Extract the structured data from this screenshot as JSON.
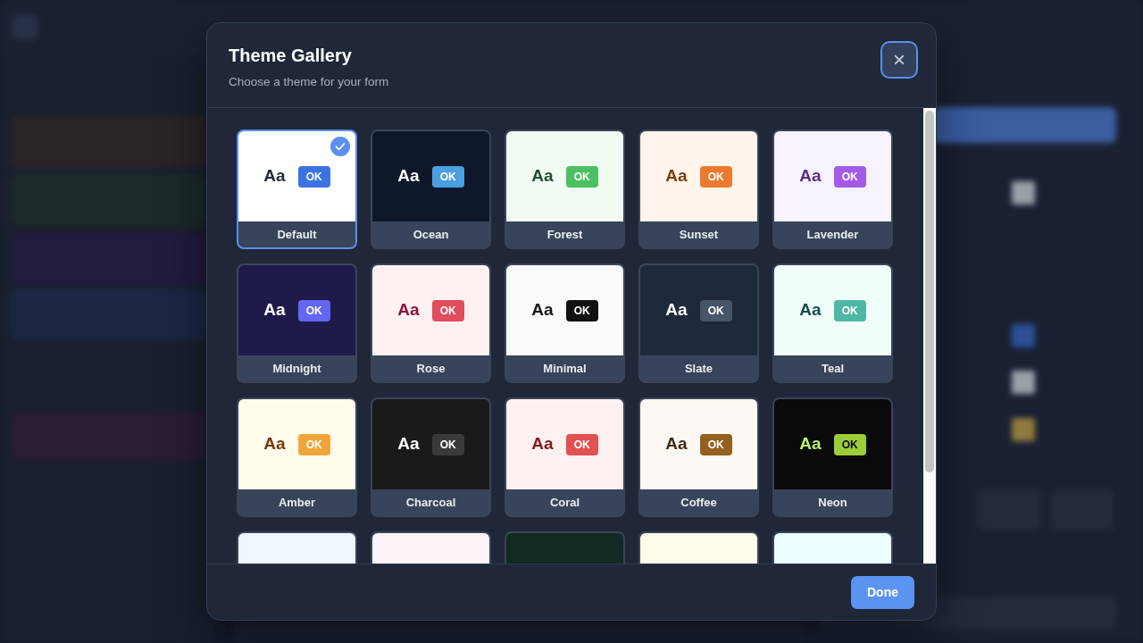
{
  "dialog": {
    "title": "Theme Gallery",
    "subtitle": "Choose a theme for your form",
    "close": "×",
    "done": "Done"
  },
  "themes": [
    {
      "name": "Default",
      "selected": true,
      "color": "#ffffff",
      "sample": {
        "text": "Aa",
        "color": "#1f2937"
      },
      "button": {
        "color": "#3b74e0",
        "label": {
          "text": "OK",
          "color": "#ffffff"
        }
      }
    },
    {
      "name": "Ocean",
      "selected": false,
      "color": "#0f172a",
      "sample": {
        "text": "Aa",
        "color": "#ffffff"
      },
      "button": {
        "color": "#4aa0e0",
        "label": {
          "text": "OK",
          "color": "#ffffff"
        }
      }
    },
    {
      "name": "Forest",
      "selected": false,
      "color": "#f0fbf2",
      "sample": {
        "text": "Aa",
        "color": "#234d2f"
      },
      "button": {
        "color": "#4cbf63",
        "label": {
          "text": "OK",
          "color": "#ffffff"
        }
      }
    },
    {
      "name": "Sunset",
      "selected": false,
      "color": "#fff5ea",
      "sample": {
        "text": "Aa",
        "color": "#7c3a12"
      },
      "button": {
        "color": "#ec7a2e",
        "label": {
          "text": "OK",
          "color": "#ffffff"
        }
      }
    },
    {
      "name": "Lavender",
      "selected": false,
      "color": "#f7f3fe",
      "sample": {
        "text": "Aa",
        "color": "#5b2b86"
      },
      "button": {
        "color": "#a35ae8",
        "label": {
          "text": "OK",
          "color": "#ffffff"
        }
      }
    },
    {
      "name": "Midnight",
      "selected": false,
      "color": "#1e1b4b",
      "sample": {
        "text": "Aa",
        "color": "#ffffff"
      },
      "button": {
        "color": "#6366f1",
        "label": {
          "text": "OK",
          "color": "#ffffff"
        }
      }
    },
    {
      "name": "Rose",
      "selected": false,
      "color": "#fff1f2",
      "sample": {
        "text": "Aa",
        "color": "#881337"
      },
      "button": {
        "color": "#e04e5e",
        "label": {
          "text": "OK",
          "color": "#ffffff"
        }
      }
    },
    {
      "name": "Minimal",
      "selected": false,
      "color": "#fafafa",
      "sample": {
        "text": "Aa",
        "color": "#171717"
      },
      "button": {
        "color": "#111111",
        "label": {
          "text": "OK",
          "color": "#ffffff"
        }
      }
    },
    {
      "name": "Slate",
      "selected": false,
      "color": "#1e293b",
      "sample": {
        "text": "Aa",
        "color": "#ffffff"
      },
      "button": {
        "color": "#475569",
        "label": {
          "text": "OK",
          "color": "#ffffff"
        }
      }
    },
    {
      "name": "Teal",
      "selected": false,
      "color": "#f0fdf9",
      "sample": {
        "text": "Aa",
        "color": "#134e4a"
      },
      "button": {
        "color": "#4fb8a5",
        "label": {
          "text": "OK",
          "color": "#ffffff"
        }
      }
    },
    {
      "name": "Amber",
      "selected": false,
      "color": "#fffbeb",
      "sample": {
        "text": "Aa",
        "color": "#78350f"
      },
      "button": {
        "color": "#f0a53a",
        "label": {
          "text": "OK",
          "color": "#ffffff"
        }
      }
    },
    {
      "name": "Charcoal",
      "selected": false,
      "color": "#1a1a1a",
      "sample": {
        "text": "Aa",
        "color": "#ffffff"
      },
      "button": {
        "color": "#3a3a3a",
        "label": {
          "text": "OK",
          "color": "#ffffff"
        }
      }
    },
    {
      "name": "Coral",
      "selected": false,
      "color": "#fff1f0",
      "sample": {
        "text": "Aa",
        "color": "#7f1d1d"
      },
      "button": {
        "color": "#e05252",
        "label": {
          "text": "OK",
          "color": "#ffffff"
        }
      }
    },
    {
      "name": "Coffee",
      "selected": false,
      "color": "#fdf8f3",
      "sample": {
        "text": "Aa",
        "color": "#3f2a14"
      },
      "button": {
        "color": "#93601f",
        "label": {
          "text": "OK",
          "color": "#ffffff"
        }
      }
    },
    {
      "name": "Neon",
      "selected": false,
      "color": "#0a0a0a",
      "sample": {
        "text": "Aa",
        "color": "#b8f26b"
      },
      "button": {
        "color": "#9ccc3a",
        "label": {
          "text": "OK",
          "color": "#0a0a0a"
        }
      }
    },
    {
      "color": "#eff6ff",
      "selected": false
    },
    {
      "color": "#fdf2f8",
      "selected": false
    },
    {
      "color": "#112a22",
      "selected": false
    },
    {
      "color": "#fefce8",
      "selected": false
    },
    {
      "color": "#ecfeff",
      "selected": false
    }
  ]
}
